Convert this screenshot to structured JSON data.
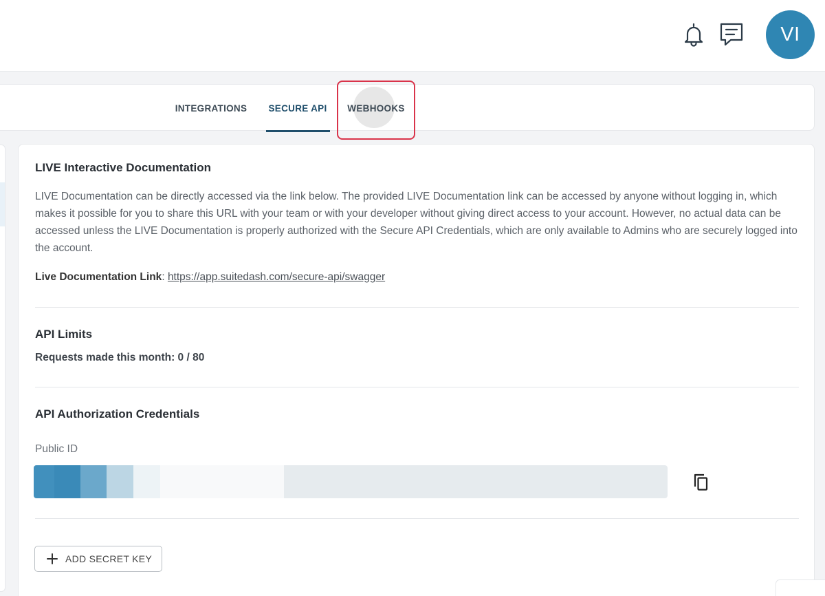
{
  "header": {
    "icons": [
      "bell-icon",
      "chat-icon"
    ],
    "avatar_initials": "VI",
    "avatar_color": "#2f86b3"
  },
  "tabs": [
    {
      "label": "INTEGRATIONS",
      "active": false
    },
    {
      "label": "SECURE API",
      "active": true
    },
    {
      "label": "WEBHOOKS",
      "active": false,
      "highlighted": true
    }
  ],
  "live_docs": {
    "title": "LIVE Interactive Documentation",
    "description": "LIVE Documentation can be directly accessed via the link below. The provided LIVE Documentation link can be accessed by anyone without logging in, which makes it possible for you to share this URL with your team or with your developer without giving direct access to your account. However, no actual data can be accessed unless the LIVE Documentation is properly authorized with the Secure API Credentials, which are only available to Admins who are securely logged into the account.",
    "link_label": "Live Documentation Link",
    "link_separator": ":",
    "link_url": "https://app.suitedash.com/secure-api/swagger"
  },
  "api_limits": {
    "title": "API Limits",
    "requests_text": "Requests made this month: 0 / 80"
  },
  "credentials": {
    "title": "API Authorization Credentials",
    "public_id_label": "Public ID",
    "public_id_value_redacted": true,
    "copy_icon": "copy-icon",
    "add_secret_key_label": "ADD SECRET KEY",
    "add_icon": "plus-icon"
  },
  "colors": {
    "accent": "#1f4e6b",
    "highlight_border": "#d9334a"
  }
}
